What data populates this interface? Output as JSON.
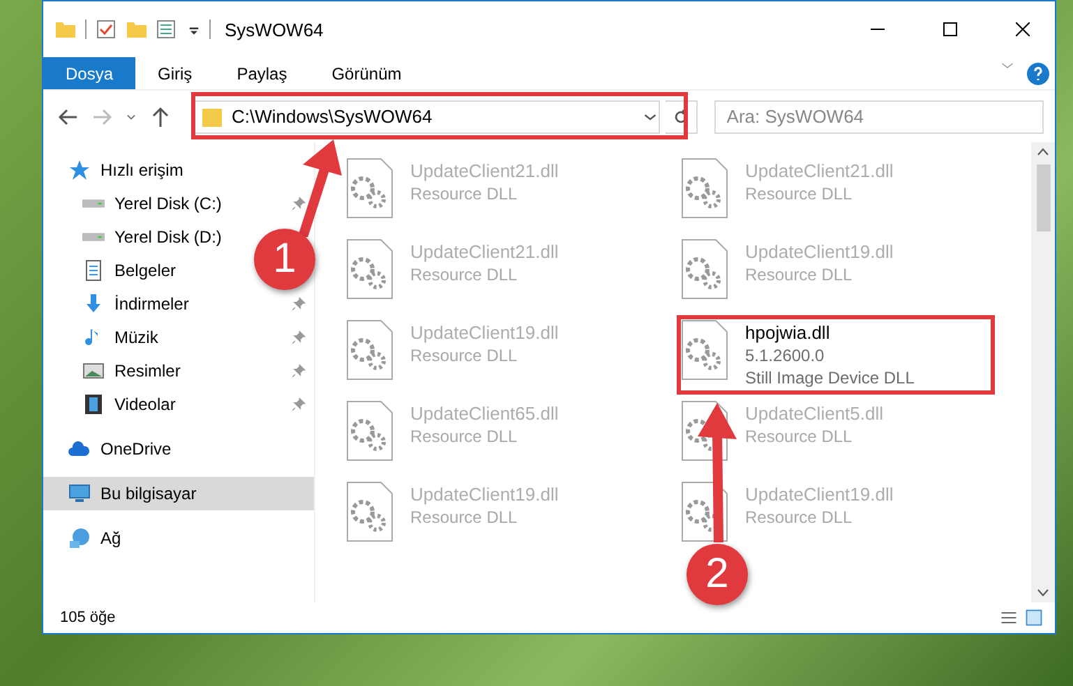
{
  "window": {
    "title": "SysWOW64"
  },
  "ribbon_tabs": [
    {
      "label": "Dosya",
      "selected": true
    },
    {
      "label": "Giriş",
      "selected": false
    },
    {
      "label": "Paylaş",
      "selected": false
    },
    {
      "label": "Görünüm",
      "selected": false
    }
  ],
  "address": {
    "path": "C:\\Windows\\SysWOW64"
  },
  "search": {
    "placeholder": "Ara: SysWOW64"
  },
  "sidebar": {
    "items": [
      {
        "label": "Hızlı erişim",
        "kind": "star",
        "selected": false,
        "pinned": false,
        "children": [
          {
            "label": "Yerel Disk (C:)",
            "kind": "drive",
            "selected": false,
            "pinned": true
          },
          {
            "label": "Yerel Disk (D:)",
            "kind": "drive",
            "selected": false,
            "pinned": false
          },
          {
            "label": "Belgeler",
            "kind": "docs",
            "selected": false,
            "pinned": false
          },
          {
            "label": "İndirmeler",
            "kind": "download",
            "selected": false,
            "pinned": true
          },
          {
            "label": "Müzik",
            "kind": "music",
            "selected": false,
            "pinned": true
          },
          {
            "label": "Resimler",
            "kind": "pictures",
            "selected": false,
            "pinned": true
          },
          {
            "label": "Videolar",
            "kind": "video",
            "selected": false,
            "pinned": true
          }
        ]
      },
      {
        "label": "OneDrive",
        "kind": "cloud",
        "selected": false,
        "pinned": false
      },
      {
        "label": "Bu bilgisayar",
        "kind": "pc",
        "selected": true,
        "pinned": false
      },
      {
        "label": "Ağ",
        "kind": "network",
        "selected": false,
        "pinned": false
      }
    ]
  },
  "files": [
    {
      "name": "UpdateClient21.dll",
      "lines": [
        "Resource DLL"
      ],
      "dimmed": true
    },
    {
      "name": "UpdateClient21.dll",
      "lines": [
        "Resource DLL"
      ],
      "dimmed": true
    },
    {
      "name": "UpdateClient21.dll",
      "lines": [
        "Resource DLL"
      ],
      "dimmed": true
    },
    {
      "name": "UpdateClient19.dll",
      "lines": [
        "Resource DLL"
      ],
      "dimmed": true
    },
    {
      "name": "UpdateClient19.dll",
      "lines": [
        "Resource DLL"
      ],
      "dimmed": true
    },
    {
      "name": "hpojwia.dll",
      "lines": [
        "5.1.2600.0",
        "Still Image Device DLL"
      ],
      "dimmed": false,
      "framed": true
    },
    {
      "name": "UpdateClient65.dll",
      "lines": [
        "Resource DLL"
      ],
      "dimmed": true
    },
    {
      "name": "UpdateClient5.dll",
      "lines": [
        "Resource DLL"
      ],
      "dimmed": true
    },
    {
      "name": "UpdateClient19.dll",
      "lines": [
        "Resource DLL"
      ],
      "dimmed": true
    },
    {
      "name": "UpdateClient19.dll",
      "lines": [
        "Resource DLL"
      ],
      "dimmed": true
    }
  ],
  "status_bar": {
    "count": "105 öğe"
  },
  "annotations": [
    {
      "label": "1"
    },
    {
      "label": "2"
    }
  ]
}
